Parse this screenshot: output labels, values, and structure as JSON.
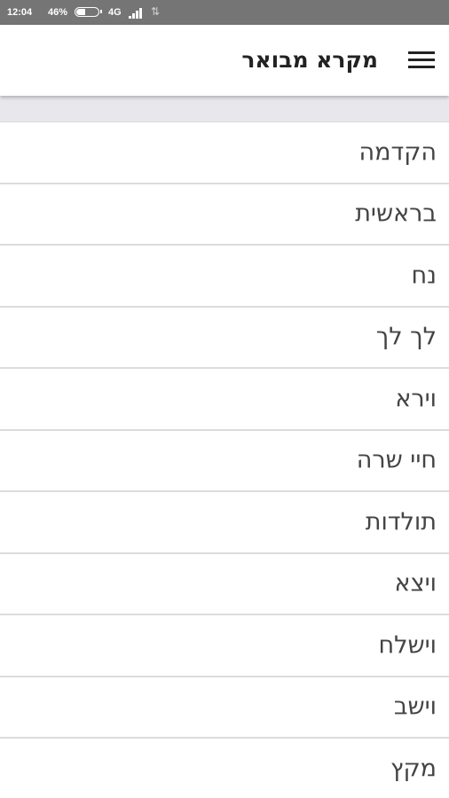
{
  "status_bar": {
    "time": "12:04",
    "battery_percent": "46%",
    "battery_level": 0.46,
    "network": "4G",
    "signal_icon": "signal-bars-icon",
    "data_icon": "data-arrows-icon",
    "data_glyph": "⇅"
  },
  "app_bar": {
    "title": "מקרא מבואר",
    "menu_icon": "hamburger-menu-icon"
  },
  "chapters": [
    {
      "label": "הקדמה"
    },
    {
      "label": "בראשית"
    },
    {
      "label": "נח"
    },
    {
      "label": "לך לך"
    },
    {
      "label": "וירא"
    },
    {
      "label": "חיי שרה"
    },
    {
      "label": "תולדות"
    },
    {
      "label": "ויצא"
    },
    {
      "label": "וישלח"
    },
    {
      "label": "וישב"
    },
    {
      "label": "מקץ"
    }
  ],
  "colors": {
    "status_bar": "#757575",
    "app_bar": "#ffffff",
    "divider": "#dcdcdc",
    "text": "#444444",
    "header_strip": "#e8e8ec"
  }
}
